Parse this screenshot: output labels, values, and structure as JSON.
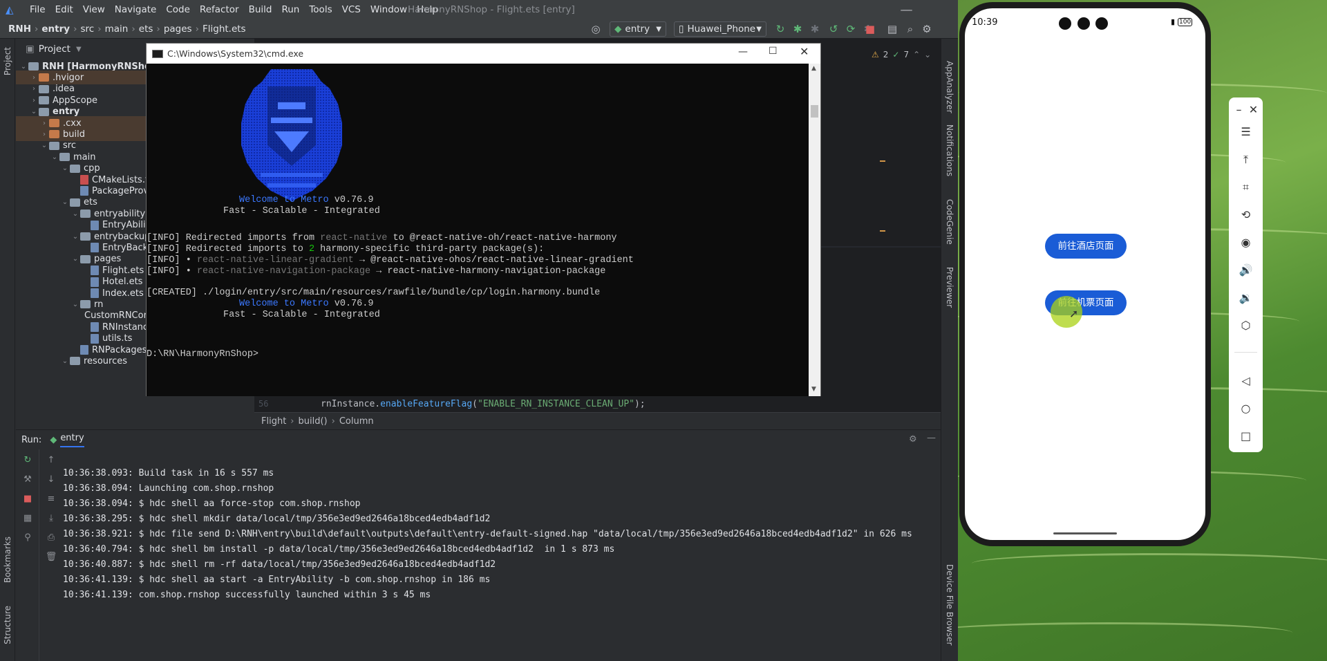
{
  "menu": [
    "File",
    "Edit",
    "View",
    "Navigate",
    "Code",
    "Refactor",
    "Build",
    "Run",
    "Tools",
    "VCS",
    "Window",
    "Help"
  ],
  "window_title": "HarmonyRNShop - Flight.ets [entry]",
  "breadcrumbs": [
    "RNH",
    "entry",
    "src",
    "main",
    "ets",
    "pages",
    "Flight.ets"
  ],
  "toolbar": {
    "config": "entry",
    "device": "Huawei_Phone"
  },
  "project": {
    "header": "Project",
    "rows": [
      {
        "label": "RNH [HarmonyRNShop]",
        "type": "root",
        "depth": 0,
        "open": true
      },
      {
        "label": ".hvigor",
        "type": "folder-orange",
        "depth": 1,
        "open": false
      },
      {
        "label": ".idea",
        "type": "folder",
        "depth": 1,
        "open": false
      },
      {
        "label": "AppScope",
        "type": "folder",
        "depth": 1,
        "open": false
      },
      {
        "label": "entry",
        "type": "folder",
        "depth": 1,
        "open": true,
        "bold": true
      },
      {
        "label": ".cxx",
        "type": "folder-orange",
        "depth": 2,
        "open": false
      },
      {
        "label": "build",
        "type": "folder-orange",
        "depth": 2,
        "open": false
      },
      {
        "label": "src",
        "type": "folder",
        "depth": 2,
        "open": true
      },
      {
        "label": "main",
        "type": "folder",
        "depth": 3,
        "open": true
      },
      {
        "label": "cpp",
        "type": "folder",
        "depth": 4,
        "open": true
      },
      {
        "label": "CMakeLists.txt",
        "type": "file-cmake",
        "depth": 5
      },
      {
        "label": "PackageProvider.cpp",
        "type": "file",
        "depth": 5
      },
      {
        "label": "ets",
        "type": "folder",
        "depth": 4,
        "open": true
      },
      {
        "label": "entryability",
        "type": "folder",
        "depth": 5,
        "open": true
      },
      {
        "label": "EntryAbility.ets",
        "type": "file",
        "depth": 6
      },
      {
        "label": "entrybackupability",
        "type": "folder",
        "depth": 5,
        "open": true
      },
      {
        "label": "EntryBackupAbility.ets",
        "type": "file",
        "depth": 6
      },
      {
        "label": "pages",
        "type": "folder",
        "depth": 5,
        "open": true
      },
      {
        "label": "Flight.ets",
        "type": "file",
        "depth": 6
      },
      {
        "label": "Hotel.ets",
        "type": "file",
        "depth": 6
      },
      {
        "label": "Index.ets",
        "type": "file",
        "depth": 6
      },
      {
        "label": "rn",
        "type": "folder",
        "depth": 5,
        "open": true
      },
      {
        "label": "CustomRNComponentFrameNodeFactory.ets",
        "type": "file",
        "depth": 6
      },
      {
        "label": "RNInstanceManager.ets",
        "type": "file",
        "depth": 6
      },
      {
        "label": "utils.ts",
        "type": "file",
        "depth": 6
      },
      {
        "label": "RNPackagesFactory.ets",
        "type": "file",
        "depth": 5
      },
      {
        "label": "resources",
        "type": "folder",
        "depth": 4,
        "open": true
      }
    ]
  },
  "editor": {
    "inspections": {
      "warnings": "2",
      "ok": "7"
    },
    "line_number": "56",
    "code_obj": "rnInstance",
    "code_method": "enableFeatureFlag",
    "code_arg": "\"ENABLE_RN_INSTANCE_CLEAN_UP\"",
    "code_end": ");",
    "crumbs": [
      "Flight",
      "build()",
      "Column"
    ]
  },
  "left_stripe": {
    "project": "Project",
    "bookmarks": "Bookmarks",
    "structure": "Structure"
  },
  "right_stripe": {
    "appanalyzer": "AppAnalyzer",
    "notifications": "Notifications",
    "codegenie": "CodeGenie",
    "previewer": "Previewer",
    "device_file_browser": "Device File Browser"
  },
  "run": {
    "label": "Run:",
    "tab": "entry",
    "lines": [
      "10:36:38.093: Build task in 16 s 557 ms",
      "10:36:38.094: Launching com.shop.rnshop",
      "10:36:38.094: $ hdc shell aa force-stop com.shop.rnshop",
      "10:36:38.295: $ hdc shell mkdir data/local/tmp/356e3ed9ed2646a18bced4edb4adf1d2",
      "10:36:38.921: $ hdc file send D:\\RNH\\entry\\build\\default\\outputs\\default\\entry-default-signed.hap \"data/local/tmp/356e3ed9ed2646a18bced4edb4adf1d2\" in 626 ms",
      "10:36:40.794: $ hdc shell bm install -p data/local/tmp/356e3ed9ed2646a18bced4edb4adf1d2  in 1 s 873 ms",
      "10:36:40.887: $ hdc shell rm -rf data/local/tmp/356e3ed9ed2646a18bced4edb4adf1d2",
      "10:36:41.139: $ hdc shell aa start -a EntryAbility -b com.shop.rnshop in 186 ms",
      "10:36:41.139: com.shop.rnshop successfully launched within 3 s 45 ms"
    ]
  },
  "cmd": {
    "title": "C:\\Windows\\System32\\cmd.exe",
    "welcome_prefix": "Welcome to ",
    "metro": "Metro",
    "version": " v0.76.9",
    "tagline": "Fast - Scalable - Integrated",
    "info1_a": "[INFO] Redirected imports from ",
    "info1_b": "react-native",
    "info1_c": " to @react-native-oh/react-native-harmony",
    "info2_a": "[INFO] Redirected imports to ",
    "info2_b": "2",
    "info2_c": " harmony-specific third-party package(s):",
    "info3_a": "[INFO] • ",
    "info3_b": "react-native-linear-gradient",
    "info3_c": " → @react-native-ohos/react-native-linear-gradient",
    "info4_a": "[INFO] • ",
    "info4_b": "react-native-navigation-package",
    "info4_c": " → react-native-harmony-navigation-package",
    "created": "[CREATED] ./login/entry/src/main/resources/rawfile/bundle/cp/login.harmony.bundle",
    "prompt": "D:\\RN\\HarmonyRnShop>"
  },
  "phone": {
    "time": "10:39",
    "battery": "100",
    "btn_hotel": "前往酒店页面",
    "btn_flight": "前往机票页面"
  },
  "colors": {
    "app_button": "#1a5cd6",
    "metro_blue": "#3b78ff",
    "cmd_bg": "#0c0c0c",
    "ide_bg": "#2b2d30"
  }
}
